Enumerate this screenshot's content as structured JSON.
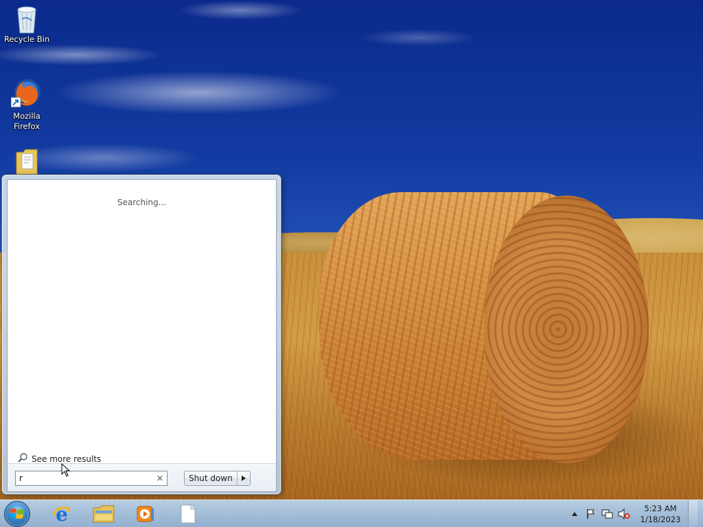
{
  "desktop": {
    "icons": [
      {
        "label": "Recycle Bin",
        "icon": "recycle-bin-icon"
      },
      {
        "label": "Mozilla\nFirefox",
        "label_line1": "Mozilla",
        "label_line2": "Firefox",
        "icon": "firefox-icon"
      },
      {
        "label": "",
        "icon": "folder-icon"
      }
    ]
  },
  "start_menu": {
    "status_text": "Searching...",
    "see_more_label": "See more results",
    "search_value": "r",
    "search_clear_glyph": "×",
    "shutdown_label": "Shut down"
  },
  "taskbar": {
    "pinned": [
      {
        "name": "internet-explorer",
        "icon": "internet-explorer-icon"
      },
      {
        "name": "windows-explorer",
        "icon": "folder-icon"
      },
      {
        "name": "windows-media-player",
        "icon": "media-player-icon"
      },
      {
        "name": "document",
        "icon": "blank-document-icon"
      }
    ],
    "tray": {
      "icons": [
        "show-hidden-icons-arrow",
        "action-center-flag-icon",
        "network-icon",
        "volume-muted-icon"
      ],
      "time": "5:23 AM",
      "date": "1/18/2023"
    }
  },
  "colors": {
    "taskbar": "#a5bfd9",
    "start_menu_frame": "#c7d6e6",
    "sky": "#123aa0"
  }
}
